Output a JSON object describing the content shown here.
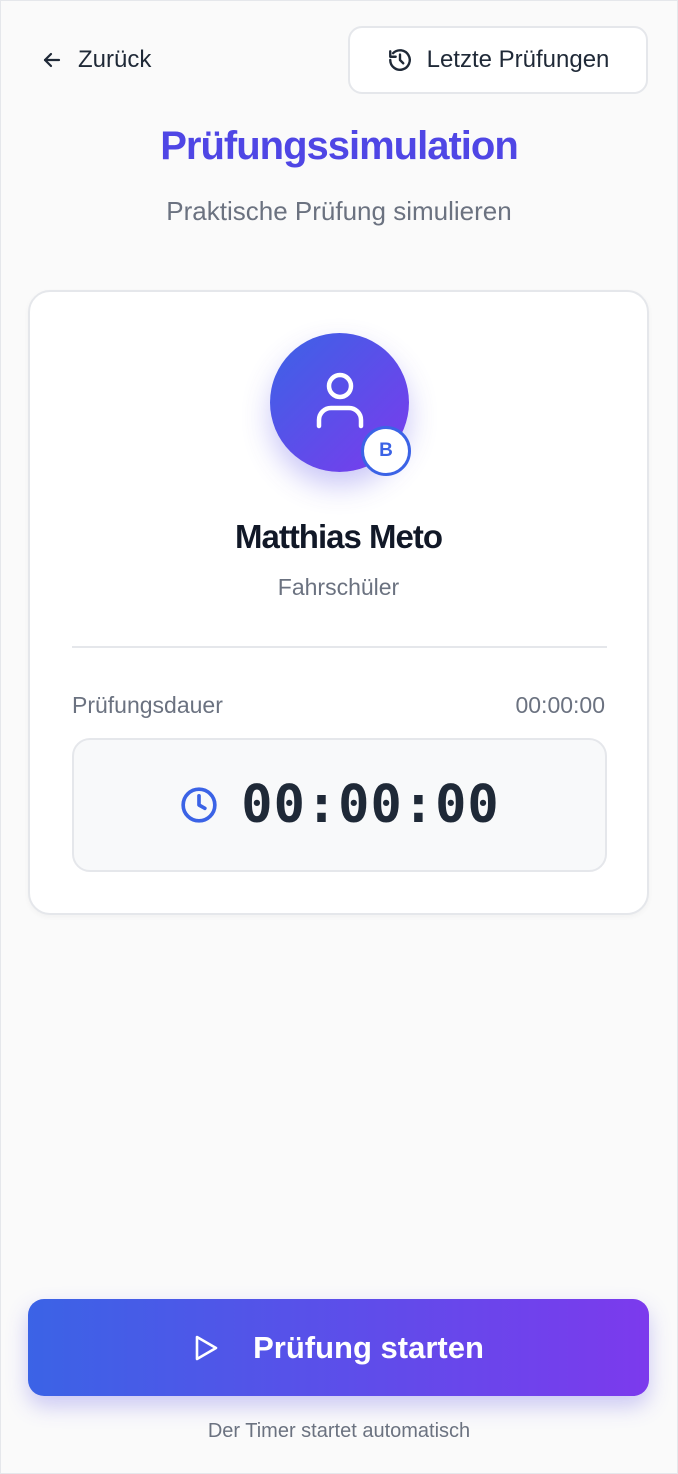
{
  "header": {
    "back_label": "Zurück",
    "recent_label": "Letzte Prüfungen"
  },
  "page": {
    "title": "Prüfungssimulation",
    "subtitle": "Praktische Prüfung simulieren"
  },
  "student": {
    "name": "Matthias Meto",
    "role": "Fahrschüler",
    "license_class": "B"
  },
  "exam": {
    "duration_label": "Prüfungsdauer",
    "duration_value": "00:00:00",
    "timer": "00:00:00"
  },
  "footer": {
    "start_label": "Prüfung starten",
    "hint": "Der Timer startet automatisch"
  },
  "icons": {
    "back": "arrow-left-icon",
    "recent": "history-icon",
    "avatar": "user-icon",
    "timer": "clock-icon",
    "start": "play-icon"
  },
  "colors": {
    "accent": "#4f46e5",
    "gradient_start": "#3b63e6",
    "gradient_end": "#7c3aed",
    "muted_text": "#6b7280"
  }
}
